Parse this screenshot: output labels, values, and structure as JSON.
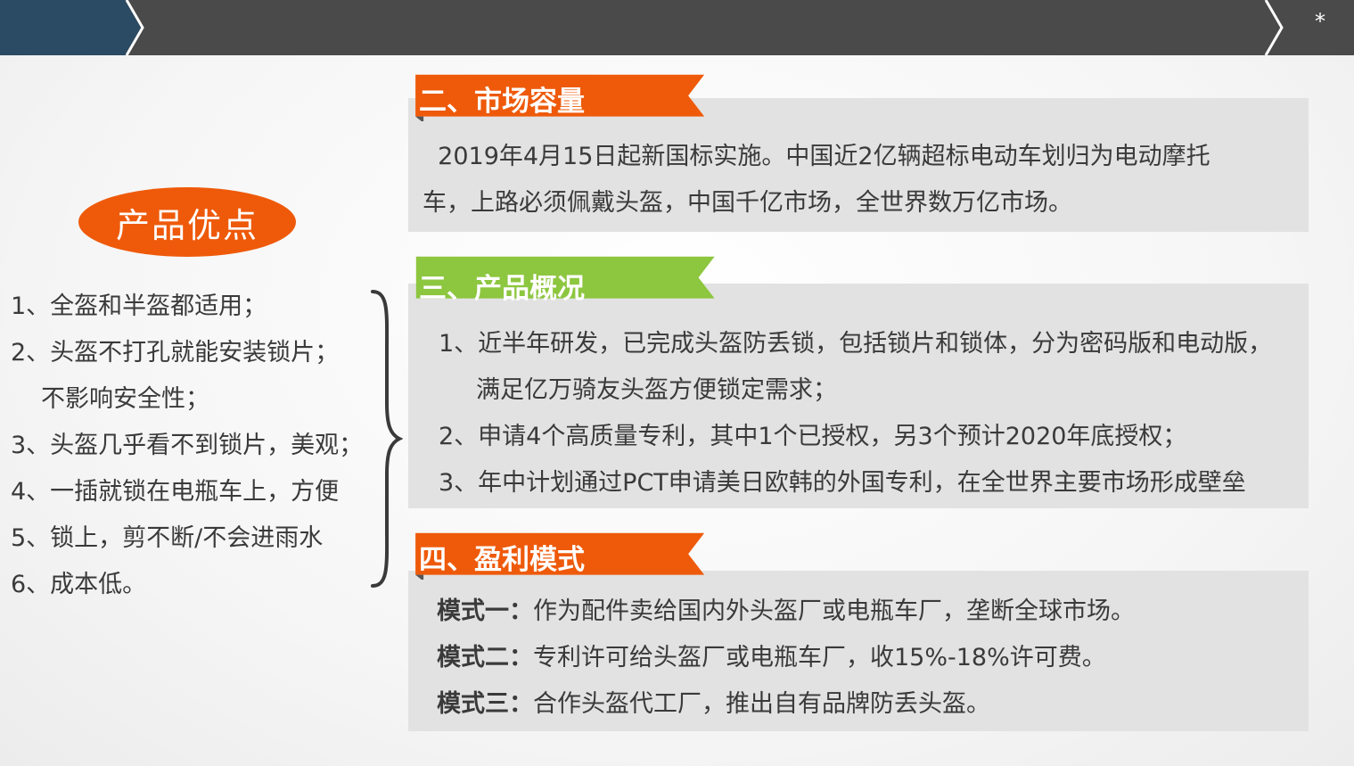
{
  "header": {
    "page_mark": "*",
    "colors": {
      "dark": "#4a4a4a",
      "navy": "#2b4a63"
    }
  },
  "left": {
    "pill_label": "产品优点",
    "items": [
      "1、全盔和半盔都适用；",
      "2、头盔不打孔就能安装锁片；",
      "不影响安全性；",
      "3、头盔几乎看不到锁片，美观；",
      "4、一插就锁在电瓶车上，方便",
      "5、锁上，剪不断/不会进雨水",
      "6、成本低。"
    ]
  },
  "sections": {
    "market": {
      "title": "二、市场容量",
      "lines": [
        "  2019年4月15日起新国标实施。中国近2亿辆超标电动车划归为电动摩托",
        "车，上路必须佩戴头盔，中国千亿市场，全世界数万亿市场。"
      ]
    },
    "product": {
      "title": "三、产品概况",
      "lines": [
        "1、近半年研发，已完成头盔防丢锁，包括锁片和锁体，分为密码版和电动版，",
        "满足亿万骑友头盔方便锁定需求；",
        "2、申请4个高质量专利，其中1个已授权，另3个预计2020年底授权；",
        "3、年中计划通过PCT申请美日欧韩的外国专利，在全世界主要市场形成壁垒"
      ]
    },
    "profit": {
      "title": "四、盈利模式",
      "modes": [
        {
          "label": "模式一：",
          "text": "作为配件卖给国内外头盔厂或电瓶车厂，垄断全球市场。"
        },
        {
          "label": "模式二：",
          "text": "专利许可给头盔厂或电瓶车厂，收15%-18%许可费。"
        },
        {
          "label": "模式三：",
          "text": "合作头盔代工厂，推出自有品牌防丢头盔。"
        }
      ]
    }
  },
  "colors": {
    "orange": "#ee5a0a",
    "green": "#8dc63f",
    "box_gray": "#e2e2e2"
  }
}
